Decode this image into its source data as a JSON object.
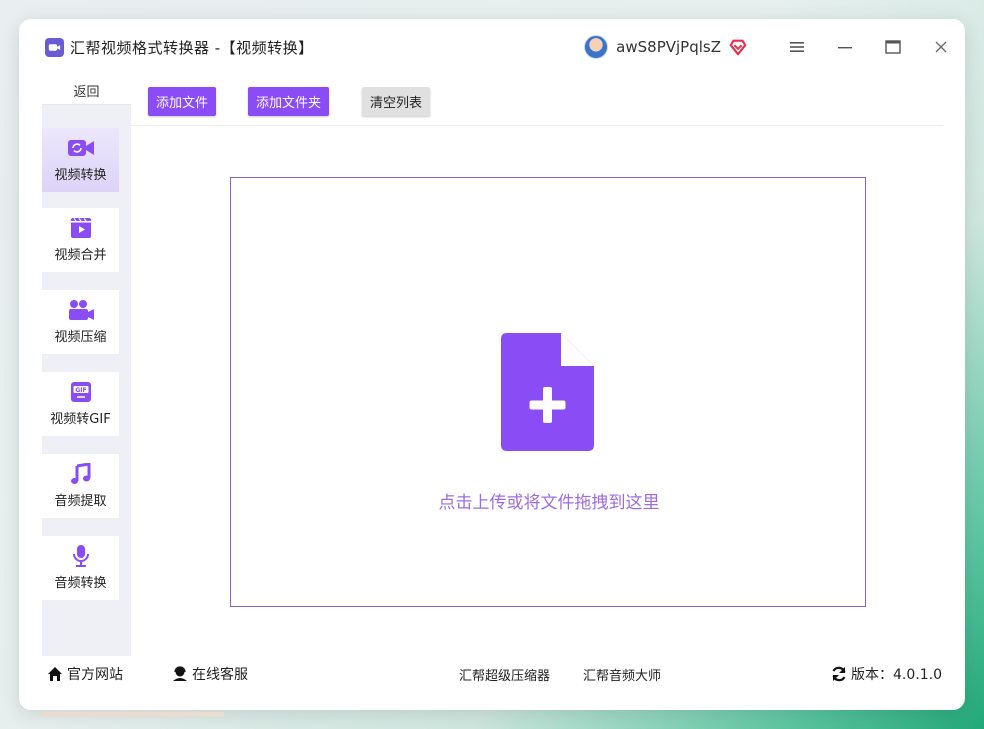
{
  "window": {
    "title": "汇帮视频格式转换器 -【视频转换】",
    "username": "awS8PVjPqlsZ"
  },
  "titlebar_icons": [
    "app-camera-icon",
    "avatar",
    "vip-diamond-icon",
    "menu-icon",
    "minimize-icon",
    "maximize-icon",
    "close-icon"
  ],
  "sidebar": {
    "back_label": "返回",
    "items": [
      {
        "label": "视频转换",
        "icon": "video-convert-icon",
        "active": true
      },
      {
        "label": "视频合并",
        "icon": "video-merge-icon",
        "active": false
      },
      {
        "label": "视频压缩",
        "icon": "video-compress-icon",
        "active": false
      },
      {
        "label": "视频转GIF",
        "icon": "gif-icon",
        "active": false
      },
      {
        "label": "音频提取",
        "icon": "music-note-icon",
        "active": false
      },
      {
        "label": "音频转换",
        "icon": "microphone-icon",
        "active": false
      }
    ]
  },
  "toolbar": {
    "add_file": "添加文件",
    "add_folder": "添加文件夹",
    "clear_list": "清空列表"
  },
  "dropzone": {
    "text": "点击上传或将文件拖拽到这里",
    "icon": "file-add-icon"
  },
  "footer": {
    "website": "官方网站",
    "support": "在线客服",
    "compressor": "汇帮超级压缩器",
    "audio_master": "汇帮音频大师",
    "version": "版本：4.0.1.0"
  },
  "colors": {
    "accent": "#8a4cf5",
    "dropzone_text": "#9d6ce0",
    "dropzone_border": "#8064c8"
  }
}
